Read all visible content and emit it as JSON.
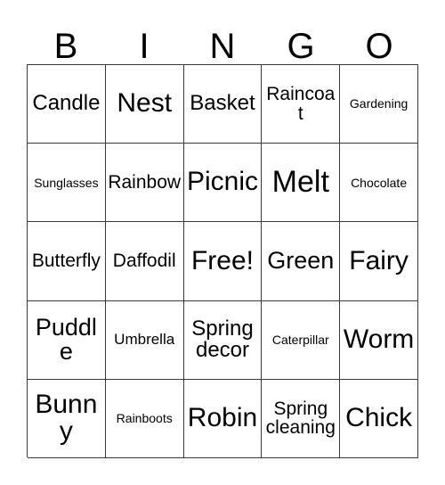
{
  "card": {
    "title": "Bingo Card",
    "header_letters": [
      "B",
      "I",
      "N",
      "G",
      "O"
    ],
    "columns": 5,
    "rows": 5,
    "background_color": "#ffffff",
    "text_color": "#000000",
    "grid_line_color": "#3a3a3a",
    "free_space_label": "Free!",
    "free_space_position": "row3-col3"
  },
  "cells": [
    [
      {
        "text": "Candle",
        "size": "lg"
      },
      {
        "text": "Nest",
        "size": "2xl"
      },
      {
        "text": "Basket",
        "size": "lg"
      },
      {
        "text": "Raincoat",
        "size": "md"
      },
      {
        "text": "Gardening",
        "size": "xs"
      }
    ],
    [
      {
        "text": "Sunglasses",
        "size": "xs"
      },
      {
        "text": "Rainbow",
        "size": "md"
      },
      {
        "text": "Picnic",
        "size": "2xl"
      },
      {
        "text": "Melt",
        "size": "3xl"
      },
      {
        "text": "Chocolate",
        "size": "xs"
      }
    ],
    [
      {
        "text": "Butterfly",
        "size": "md"
      },
      {
        "text": "Daffodil",
        "size": "md"
      },
      {
        "text": "Free!",
        "size": "2xl"
      },
      {
        "text": "Green",
        "size": "xl"
      },
      {
        "text": "Fairy",
        "size": "2xl"
      }
    ],
    [
      {
        "text": "Puddle",
        "size": "xl"
      },
      {
        "text": "Umbrella",
        "size": "sm"
      },
      {
        "text": "Spring decor",
        "size": "lg"
      },
      {
        "text": "Caterpillar",
        "size": "xs"
      },
      {
        "text": "Worm",
        "size": "2xl"
      }
    ],
    [
      {
        "text": "Bunny",
        "size": "2xl"
      },
      {
        "text": "Rainboots",
        "size": "xs"
      },
      {
        "text": "Robin",
        "size": "2xl"
      },
      {
        "text": "Spring cleaning",
        "size": "md"
      },
      {
        "text": "Chick",
        "size": "2xl"
      }
    ]
  ]
}
